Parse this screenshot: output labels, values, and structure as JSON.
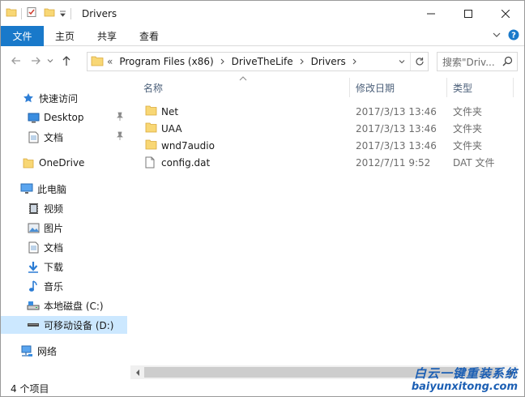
{
  "window": {
    "title": "Drivers"
  },
  "ribbon": {
    "tabs": [
      "文件",
      "主页",
      "共享",
      "查看"
    ]
  },
  "address": {
    "overflow": "«",
    "crumbs": [
      "Program Files (x86)",
      "DriveTheLife",
      "Drivers"
    ]
  },
  "search": {
    "placeholder": "搜索\"Driv..."
  },
  "nav": {
    "quick_access": "快速访问",
    "desktop": "Desktop",
    "documents_pinned": "文档",
    "onedrive": "OneDrive",
    "this_pc": "此电脑",
    "videos": "视频",
    "pictures": "图片",
    "documents": "文档",
    "downloads": "下载",
    "music": "音乐",
    "local_disk": "本地磁盘 (C:)",
    "removable": "可移动设备 (D:)",
    "network": "网络"
  },
  "columns": {
    "name": "名称",
    "modified": "修改日期",
    "type": "类型"
  },
  "files": [
    {
      "name": "Net",
      "date": "2017/3/13 13:46",
      "type": "文件夹",
      "icon": "folder-icon"
    },
    {
      "name": "UAA",
      "date": "2017/3/13 13:46",
      "type": "文件夹",
      "icon": "folder-icon"
    },
    {
      "name": "wnd7audio",
      "date": "2017/3/13 13:46",
      "type": "文件夹",
      "icon": "folder-icon"
    },
    {
      "name": "config.dat",
      "date": "2012/7/11 9:52",
      "type": "DAT 文件",
      "icon": "file-icon"
    }
  ],
  "status": {
    "count": "4 个项目"
  },
  "watermark": {
    "line1": "白云一键重装系统",
    "line2": "baiyunxitong.com"
  },
  "colors": {
    "accent": "#1979ca",
    "folder": "#f8d775",
    "selected": "#cce8ff"
  }
}
